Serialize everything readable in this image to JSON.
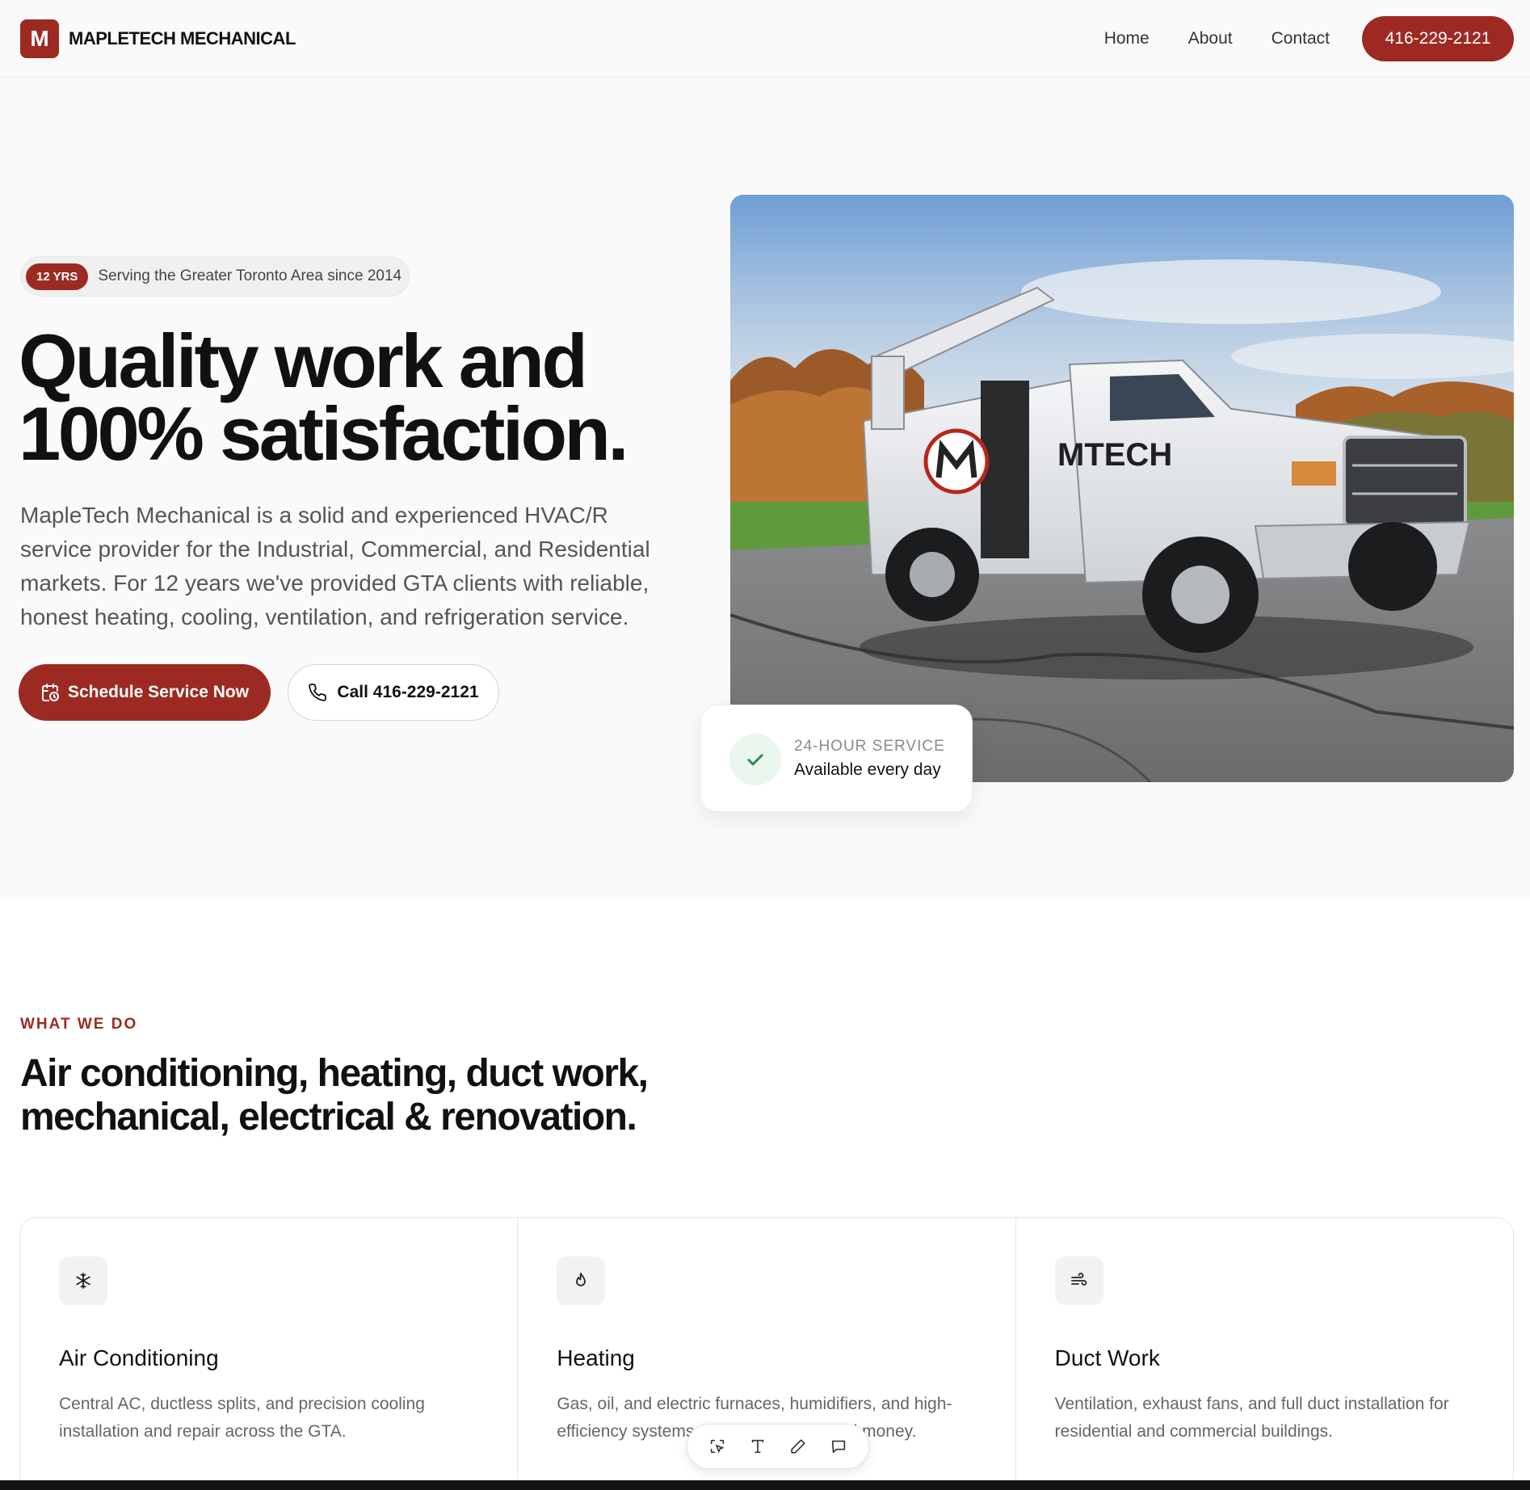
{
  "brand": {
    "mark": "M",
    "name": "MAPLETECH MECHANICAL"
  },
  "nav": {
    "home": "Home",
    "about": "About",
    "contact": "Contact",
    "phone": "416-229-2121"
  },
  "hero": {
    "badge": "12 YRS",
    "since": "Serving the Greater Toronto Area since 2014",
    "title_line1": "Quality work and",
    "title_line2": "100% satisfaction.",
    "description": "MapleTech Mechanical is a solid and experienced HVAC/R service provider for the Industrial, Commercial, and Residential markets. For 12 years we've provided GTA clients with reliable, honest heating, cooling, ventilation, and refrigeration service.",
    "primary_cta": "Schedule Service Now",
    "secondary_cta": "Call 416-229-2121",
    "photo_truck_text": "MTECH",
    "service_eyebrow": "24-HOUR SERVICE",
    "service_text": "Available every day"
  },
  "services": {
    "eyebrow": "WHAT WE DO",
    "title_line1": "Air conditioning, heating, duct work,",
    "title_line2": "mechanical, electrical & renovation.",
    "cards": [
      {
        "icon": "snowflake-icon",
        "title": "Air Conditioning",
        "description": "Central AC, ductless splits, and precision cooling installation and repair across the GTA."
      },
      {
        "icon": "flame-icon",
        "title": "Heating",
        "description": "Gas, oil, and electric furnaces, humidifiers, and high-efficiency systems that save energy and money."
      },
      {
        "icon": "wind-icon",
        "title": "Duct Work",
        "description": "Ventilation, exhaust fans, and full duct installation for residential and commercial buildings."
      }
    ]
  },
  "colors": {
    "brand": "#9d2a22",
    "success": "#2e8b4a",
    "background": "#fafafa"
  }
}
